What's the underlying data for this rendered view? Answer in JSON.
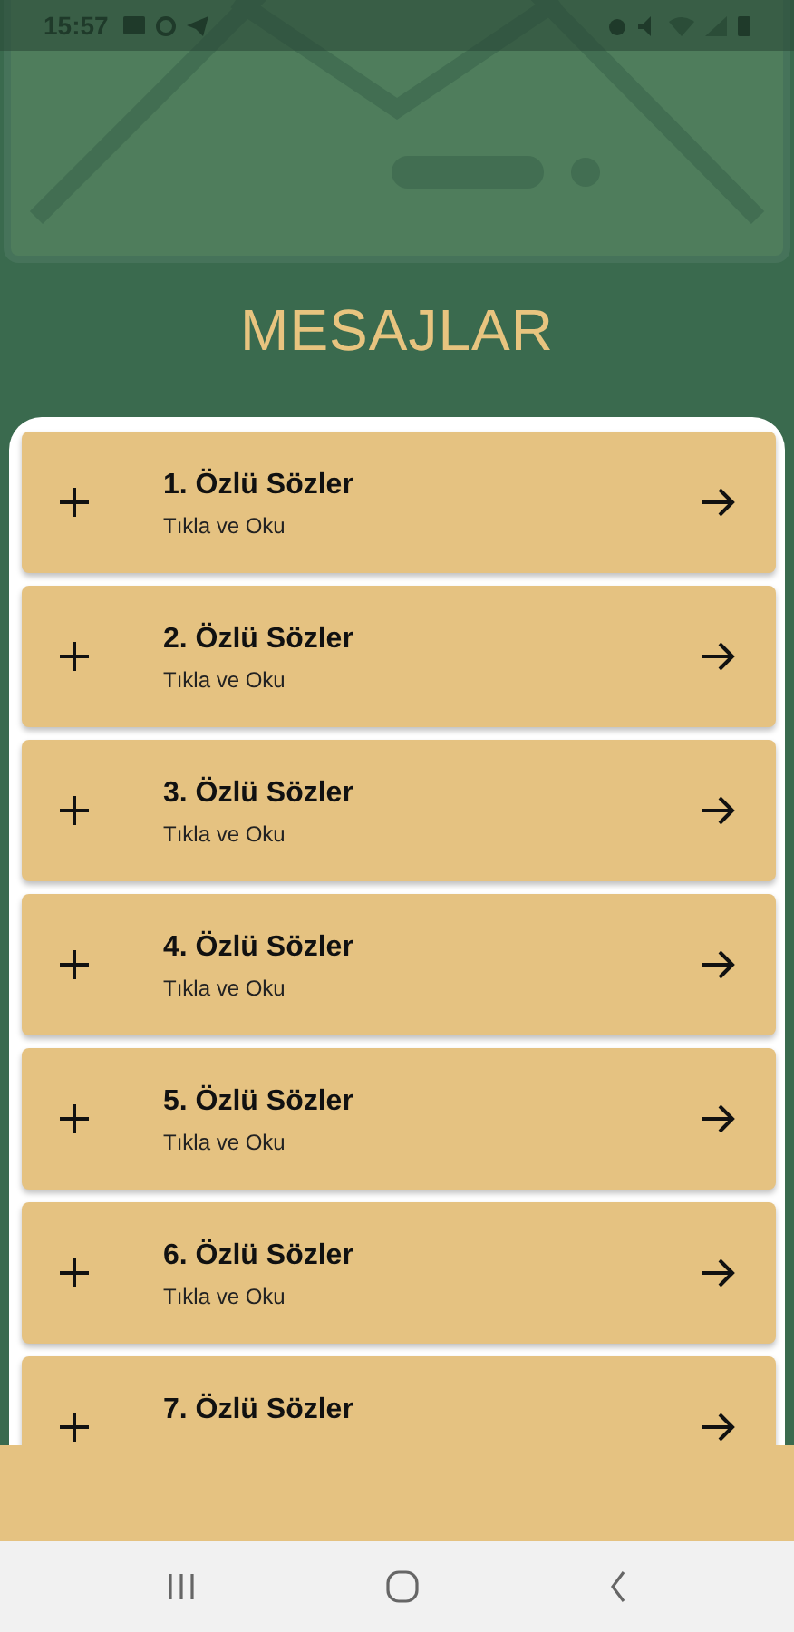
{
  "status_bar": {
    "time": "15:57"
  },
  "title": "MESAJLAR",
  "items": [
    {
      "title": "1. Özlü Sözler",
      "subtitle": "Tıkla ve Oku"
    },
    {
      "title": "2. Özlü Sözler",
      "subtitle": "Tıkla ve Oku"
    },
    {
      "title": "3. Özlü Sözler",
      "subtitle": "Tıkla ve Oku"
    },
    {
      "title": "4. Özlü Sözler",
      "subtitle": "Tıkla ve Oku"
    },
    {
      "title": "5. Özlü Sözler",
      "subtitle": "Tıkla ve Oku"
    },
    {
      "title": "6. Özlü Sözler",
      "subtitle": "Tıkla ve Oku"
    },
    {
      "title": "7. Özlü Sözler"
    }
  ]
}
